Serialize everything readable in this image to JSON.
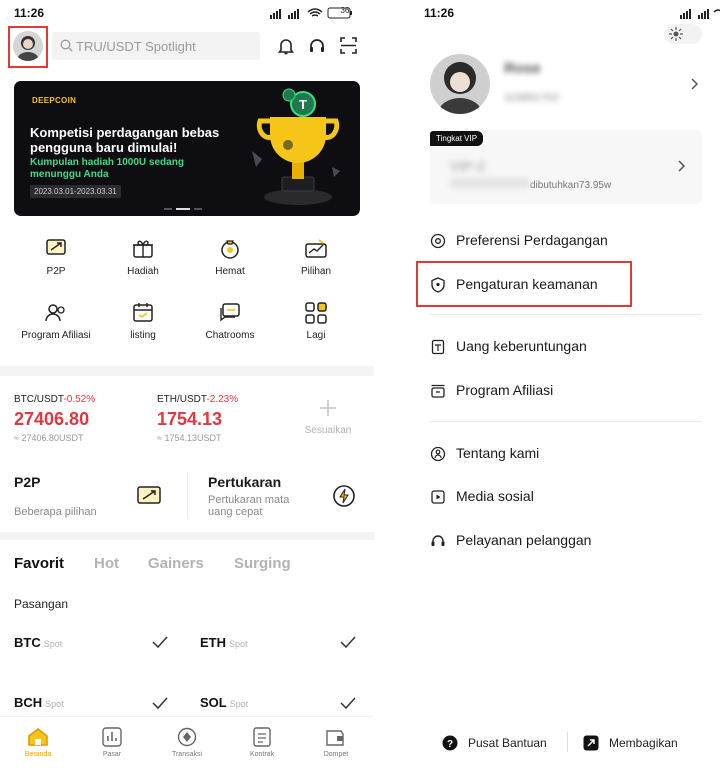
{
  "left": {
    "time": "11:26",
    "battery": "36",
    "search_placeholder": "TRU/USDT Spotlight",
    "banner": {
      "brand": "DEEPCOIN",
      "headline": "Kompetisi perdagangan bebas pengguna baru dimulai!",
      "subline": "Kumpulan hadiah 1000U sedang menunggu Anda",
      "dates": "2023.03.01-2023.03.31"
    },
    "menu": [
      {
        "label": "P2P",
        "icon": "p2p-icon"
      },
      {
        "label": "Hadiah",
        "icon": "gift-icon"
      },
      {
        "label": "Hemat",
        "icon": "savings-icon"
      },
      {
        "label": "Pilihan",
        "icon": "options-icon"
      },
      {
        "label": "Program Afiliasi",
        "icon": "affiliate-icon"
      },
      {
        "label": "listing",
        "icon": "listing-icon"
      },
      {
        "label": "Chatrooms",
        "icon": "chat-icon"
      },
      {
        "label": "Lagi",
        "icon": "more-grid-icon"
      }
    ],
    "tickers": [
      {
        "pair": "BTC/USDT",
        "change": "-0.52%",
        "price": "27406.80",
        "converted": "≈ 27406.80USDT"
      },
      {
        "pair": "ETH/USDT",
        "change": "-2.23%",
        "price": "1754.13",
        "converted": "≈ 1754.13USDT"
      }
    ],
    "customize_label": "Sesuaikan",
    "p2p_card": {
      "title": "P2P",
      "subtitle": "Beberapa pilihan"
    },
    "exchange_card": {
      "title": "Pertukaran",
      "subtitle": "Pertukaran mata uang cepat"
    },
    "tabs": [
      "Favorit",
      "Hot",
      "Gainers",
      "Surging"
    ],
    "pairs_heading": "Pasangan",
    "pairs": [
      {
        "base": "BTC",
        "type": "Spot"
      },
      {
        "base": "ETH",
        "type": "Spot"
      },
      {
        "base": "BCH",
        "type": "Spot"
      },
      {
        "base": "SOL",
        "type": "Spot"
      }
    ],
    "bottom_nav": [
      {
        "label": "Beranda",
        "icon": "home-icon"
      },
      {
        "label": "Pasar",
        "icon": "market-icon"
      },
      {
        "label": "Transaksi",
        "icon": "trade-icon"
      },
      {
        "label": "Kontrak",
        "icon": "contract-icon"
      },
      {
        "label": "Dompet",
        "icon": "wallet-icon"
      }
    ]
  },
  "right": {
    "time": "11:26",
    "username": "Rose",
    "user_id": "103891702",
    "vip_tag": "Tingkat VIP",
    "vip_level": "VIP-2",
    "vip_required": "dibutuhkan73.95w",
    "menu": [
      {
        "label": "Preferensi Perdagangan",
        "icon": "preferences-icon"
      },
      {
        "label": "Pengaturan keamanan",
        "icon": "shield-icon"
      },
      {
        "label": "Uang keberuntungan",
        "icon": "lucky-money-icon"
      },
      {
        "label": "Program Afiliasi",
        "icon": "affiliate-icon"
      },
      {
        "label": "Tentang kami",
        "icon": "about-icon"
      },
      {
        "label": "Media sosial",
        "icon": "media-icon"
      },
      {
        "label": "Pelayanan pelanggan",
        "icon": "support-icon"
      }
    ],
    "footer": [
      {
        "label": "Pusat Bantuan",
        "icon": "help-icon"
      },
      {
        "label": "Membagikan",
        "icon": "share-icon"
      }
    ]
  },
  "colors": {
    "accent": "#f0a500",
    "down": "#e0383e",
    "highlight": "#e53935",
    "promo": "#3ddc84"
  }
}
